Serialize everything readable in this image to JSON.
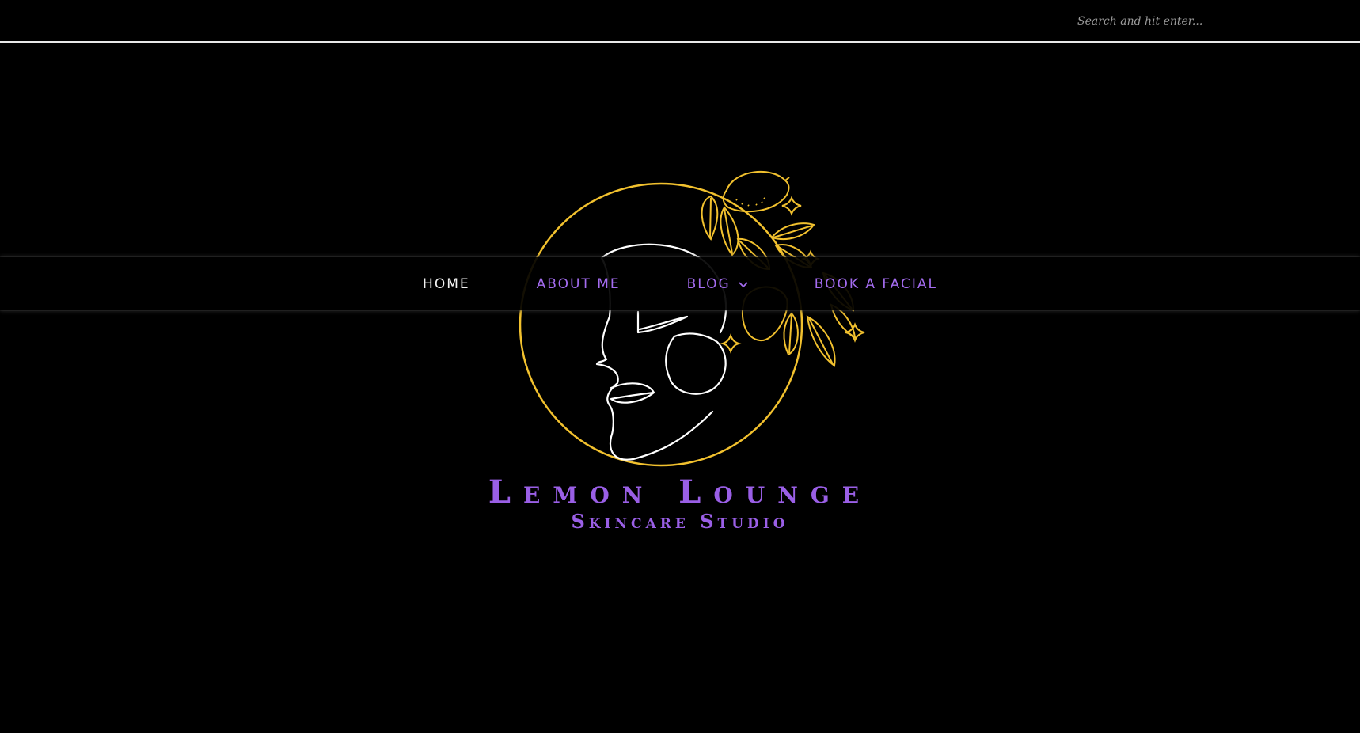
{
  "search": {
    "placeholder": "Search and hit enter..."
  },
  "brand": {
    "title": "Lemon Lounge",
    "subtitle": "Skincare Studio"
  },
  "nav": {
    "items": [
      {
        "label": "HOME",
        "active": true
      },
      {
        "label": "ABOUT ME",
        "active": false
      },
      {
        "label": "BLOG",
        "active": false,
        "has_dropdown": true
      },
      {
        "label": "BOOK A FACIAL",
        "active": false
      }
    ]
  },
  "colors": {
    "background": "#000000",
    "accent_purple": "#9a5fe6",
    "logo_gold": "#f2c12e",
    "logo_line_white": "#ffffff",
    "nav_active": "#f2f2f2"
  },
  "icons": {
    "dropdown": "chevron-down-icon",
    "logo": "face-lemon-logo"
  }
}
